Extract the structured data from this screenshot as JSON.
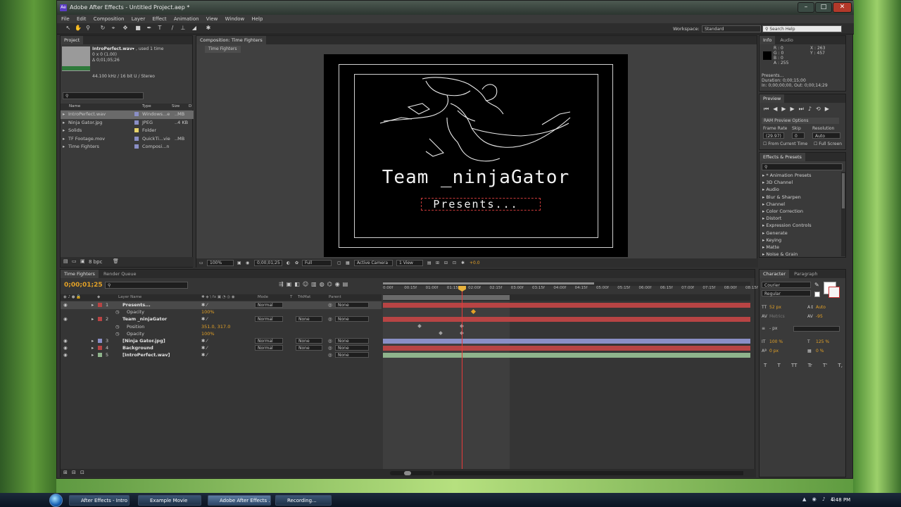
{
  "window": {
    "title": "Adobe After Effects - Untitled Project.aep *",
    "icon": "Ae"
  },
  "menu": [
    "File",
    "Edit",
    "Composition",
    "Layer",
    "Effect",
    "Animation",
    "View",
    "Window",
    "Help"
  ],
  "toolbar": {
    "workspace_label": "Workspace:",
    "workspace_value": "Standard",
    "search_placeholder": "Search Help"
  },
  "project": {
    "tab": "Project",
    "file_name": "IntroPerfect.wav▾",
    "used": ", used 1 time",
    "line1": "0 x 0 (1.00)",
    "line2": "Δ 0;01;05;26",
    "line3": "44.100 kHz / 16 bit U / Stereo",
    "columns": {
      "name": "Name",
      "type": "Type",
      "size": "Size",
      "dur": "D"
    },
    "items": [
      {
        "name": "IntroPerfect.wav",
        "type": "Windows...e",
        "size": "..MB",
        "color": "#8a8fc6"
      },
      {
        "name": "Ninja Gator.jpg",
        "type": "JPEG",
        "size": "..4 KB",
        "color": "#8a8fc6"
      },
      {
        "name": "Solids",
        "type": "Folder",
        "size": "",
        "color": "#e6d36a"
      },
      {
        "name": "TF Footage.mov",
        "type": "QuickTi...vie",
        "size": "..MB",
        "color": "#8a8fc6"
      },
      {
        "name": "Time Fighters",
        "type": "Composi...n",
        "size": "",
        "color": "#8a8fc6"
      }
    ],
    "bpc": "8 bpc"
  },
  "composition": {
    "tab": "Composition: Time Fighters",
    "crumb": "Time Fighters",
    "title_text": "Team _ninjaGator",
    "subtitle_text": "Presents...",
    "zoom": "100%",
    "timecode": "0;00;01;25",
    "resolution": "Full",
    "camera": "Active Camera",
    "views": "1 View",
    "exposure": "+0.0"
  },
  "info": {
    "tabs": [
      "Info",
      "Audio"
    ],
    "r": "R : 0",
    "g": "G : 0",
    "b": "B : 0",
    "a": "A : 255",
    "x": "X : 263",
    "y": "Y : 457",
    "layer": "Presents...",
    "duration": "Duration: 0;00;15;00",
    "inout": "In: 0;00;00;00, Out: 0;00;14;29"
  },
  "preview": {
    "tab": "Preview",
    "ram": "RAM Preview Options",
    "frame_rate_label": "Frame Rate",
    "skip_label": "Skip",
    "resolution_label": "Resolution",
    "frame_rate": "(29.97)",
    "skip": "0",
    "resolution": "Auto",
    "from_current": "From Current Time",
    "full_screen": "Full Screen"
  },
  "effects": {
    "tab": "Effects & Presets",
    "items": [
      "* Animation Presets",
      "3D Channel",
      "Audio",
      "Blur & Sharpen",
      "Channel",
      "Color Correction",
      "Distort",
      "Expression Controls",
      "Generate",
      "Keying",
      "Matte",
      "Noise & Grain"
    ]
  },
  "character": {
    "tabs": [
      "Character",
      "Paragraph"
    ],
    "font": "Courier",
    "style": "Regular",
    "size": "52 px",
    "leading": "Auto",
    "kerning": "Metrics",
    "tracking": "-95",
    "stroke": "- px",
    "vscale": "100 %",
    "hscale": "125 %",
    "baseline": "0 px",
    "tsume": "0 %",
    "styles": [
      "T",
      "T",
      "TT",
      "Tr",
      "T'",
      "T,"
    ]
  },
  "timeline": {
    "tabs": [
      "Time Fighters",
      "Render Queue"
    ],
    "timecode": "0;00;01;25",
    "headers": {
      "layer": "Layer Name",
      "mode": "Mode",
      "t": "T",
      "trkmat": "TrkMat",
      "parent": "Parent"
    },
    "ruler": [
      "0:00f",
      "00:15f",
      "01:00f",
      "01:15f",
      "02:00f",
      "02:15f",
      "03:00f",
      "03:15f",
      "04:00f",
      "04:15f",
      "05:00f",
      "05:15f",
      "06:00f",
      "06:15f",
      "07:00f",
      "07:15f",
      "08:00f",
      "08:15f"
    ],
    "layers": [
      {
        "num": "1",
        "name": "Presents...",
        "mode": "Normal",
        "trkmat": "",
        "parent": "None",
        "color": "#b84444"
      },
      {
        "num": "2",
        "name": "Team _ninjaGator",
        "mode": "Normal",
        "trkmat": "None",
        "parent": "None",
        "color": "#b84444"
      },
      {
        "num": "3",
        "name": "[Ninja Gator.jpg]",
        "mode": "Normal",
        "trkmat": "None",
        "parent": "None",
        "color": "#8a8fc6"
      },
      {
        "num": "4",
        "name": "Background",
        "mode": "Normal",
        "trkmat": "None",
        "parent": "None",
        "color": "#b84444"
      },
      {
        "num": "5",
        "name": "[IntroPerfect.wav]",
        "mode": "",
        "trkmat": "",
        "parent": "None",
        "color": "#8fb48c"
      }
    ],
    "props": {
      "opacity1_label": "Opacity",
      "opacity1": "100%",
      "position_label": "Position",
      "position": "351.0, 317.0",
      "opacity2_label": "Opacity",
      "opacity2": "100%"
    }
  },
  "taskbar": {
    "items": [
      "After Effects - Intro",
      "Example Movie",
      "Adobe After Effects ...",
      "Recording..."
    ],
    "clock": "4:48 PM"
  }
}
